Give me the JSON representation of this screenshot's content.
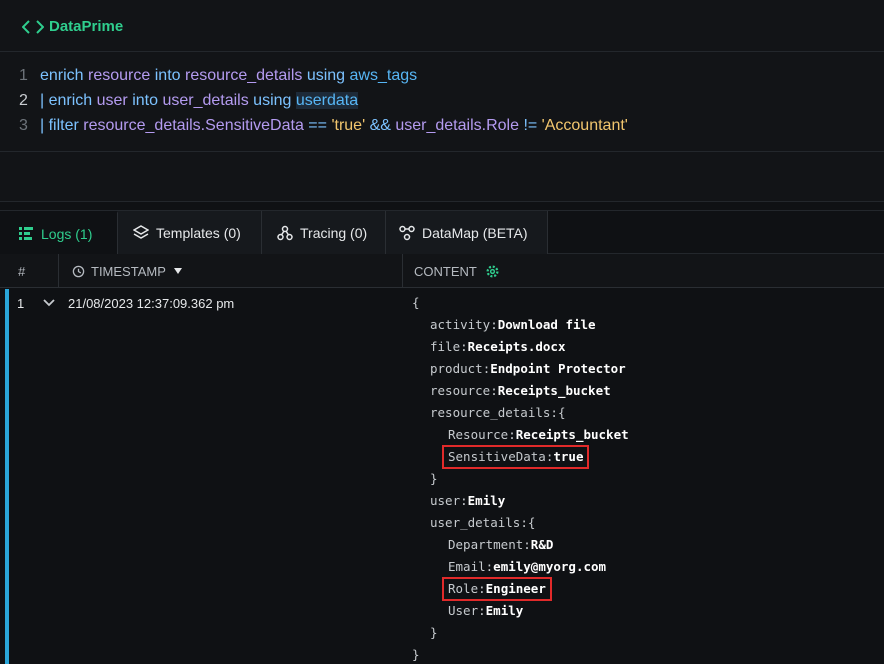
{
  "header": {
    "title": "DataPrime",
    "icon": "code-brackets-icon"
  },
  "editor": {
    "lines": [
      {
        "num": "1",
        "tokens": [
          {
            "t": "enrich ",
            "c": "kw"
          },
          {
            "t": "resource ",
            "c": "id"
          },
          {
            "t": "into ",
            "c": "kw"
          },
          {
            "t": "resource_details ",
            "c": "id"
          },
          {
            "t": "using ",
            "c": "kw"
          },
          {
            "t": "aws_tags",
            "c": "fn"
          }
        ]
      },
      {
        "num": "2",
        "tokens": [
          {
            "t": "| enrich ",
            "c": "kw"
          },
          {
            "t": "user ",
            "c": "id"
          },
          {
            "t": "into ",
            "c": "kw"
          },
          {
            "t": "user_details ",
            "c": "id"
          },
          {
            "t": "using ",
            "c": "kw"
          },
          {
            "t": "userdata",
            "c": "fn hl"
          }
        ]
      },
      {
        "num": "3",
        "tokens": [
          {
            "t": "| filter ",
            "c": "kw"
          },
          {
            "t": "resource_details.SensitiveData ",
            "c": "id"
          },
          {
            "t": "== ",
            "c": "kw"
          },
          {
            "t": "'true' ",
            "c": "str"
          },
          {
            "t": "&& ",
            "c": "kw"
          },
          {
            "t": "user_details.Role ",
            "c": "id"
          },
          {
            "t": "!= ",
            "c": "kw"
          },
          {
            "t": "'Accountant'",
            "c": "str"
          }
        ]
      }
    ]
  },
  "tabs": [
    {
      "label": "Logs (1)",
      "icon": "logs-icon",
      "active": true
    },
    {
      "label": "Templates (0)",
      "icon": "layers-icon",
      "active": false
    },
    {
      "label": "Tracing (0)",
      "icon": "tracing-icon",
      "active": false
    },
    {
      "label": "DataMap (BETA)",
      "icon": "datamap-icon",
      "active": false
    }
  ],
  "table": {
    "columns": {
      "num": "#",
      "timestamp": "TIMESTAMP",
      "content": "CONTENT"
    },
    "row": {
      "num": "1",
      "timestamp": "21/08/2023 12:37:09.362 pm",
      "json": [
        {
          "text": "{"
        },
        {
          "key": "activity",
          "value": "Download file"
        },
        {
          "key": "file",
          "value": "Receipts.docx"
        },
        {
          "key": "product",
          "value": "Endpoint Protector"
        },
        {
          "key": "resource",
          "value": "Receipts_bucket"
        },
        {
          "key": "resource_details",
          "value": "",
          "open": "{"
        },
        {
          "key": "Resource",
          "value": "Receipts_bucket",
          "indent": 2
        },
        {
          "key": "SensitiveData",
          "value": "true",
          "indent": 2,
          "highlight": true
        },
        {
          "text": "}"
        },
        {
          "key": "user",
          "value": "Emily"
        },
        {
          "key": "user_details",
          "value": "",
          "open": "{"
        },
        {
          "key": "Department",
          "value": "R&D",
          "indent": 2
        },
        {
          "key": "Email",
          "value": "emily@myorg.com",
          "indent": 2
        },
        {
          "key": "Role",
          "value": "Engineer",
          "indent": 2,
          "highlight": true
        },
        {
          "key": "User",
          "value": "Emily",
          "indent": 2
        },
        {
          "text": "}"
        },
        {
          "text": "}",
          "indent": 0
        }
      ]
    }
  },
  "colors": {
    "accent": "#2fce8e",
    "highlight_box": "#e12a2a",
    "row_marker": "#2aa6d9"
  }
}
